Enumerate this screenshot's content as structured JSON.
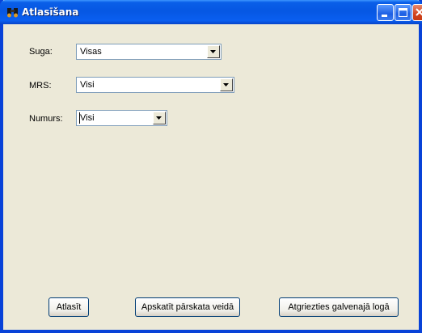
{
  "window": {
    "title": "Atlasīšana"
  },
  "form": {
    "species": {
      "label": "Suga:",
      "value": "Visas"
    },
    "mrs": {
      "label": "MRS:",
      "value": "Visi"
    },
    "number": {
      "label": "Numurs:",
      "value": "Visi"
    }
  },
  "buttons": {
    "select": "Atlasīt",
    "report_view": "Apskatīt pārskata veidā",
    "back_main": "Atgriezties galvenajā logā"
  },
  "icons": {
    "app": "binoculars-icon",
    "minimize": "minimize-icon",
    "maximize": "maximize-icon",
    "close": "close-icon",
    "dropdown": "chevron-down-icon"
  },
  "colors": {
    "titlebar": "#0657e3",
    "window_bg": "#ece9d8",
    "close_button": "#d2441d"
  }
}
